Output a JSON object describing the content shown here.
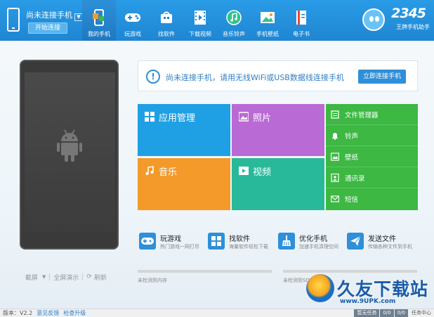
{
  "header": {
    "device_name": "尚未连接手机",
    "connect_label": "开始连接",
    "nav": [
      {
        "label": "我的手机",
        "icon": "phone-icon",
        "active": true
      },
      {
        "label": "玩游戏",
        "icon": "gamepad-icon"
      },
      {
        "label": "找软件",
        "icon": "app-store-icon"
      },
      {
        "label": "下载视频",
        "icon": "film-icon"
      },
      {
        "label": "音乐铃声",
        "icon": "music-note-icon"
      },
      {
        "label": "手机壁纸",
        "icon": "image-icon"
      },
      {
        "label": "电子书",
        "icon": "book-icon"
      }
    ],
    "brand_number": "2345",
    "brand_subtitle": "王牌手机助手"
  },
  "notice": {
    "text": "尚未连接手机，请用无线WiFi或USB数据线连接手机",
    "button": "立即连接手机"
  },
  "tiles": {
    "apps": "应用管理",
    "photos": "照片",
    "music": "音乐",
    "video": "视频"
  },
  "side_menu": [
    {
      "label": "文件管理器",
      "icon": "folder-icon"
    },
    {
      "label": "铃声",
      "icon": "bell-icon"
    },
    {
      "label": "壁纸",
      "icon": "wallpaper-icon"
    },
    {
      "label": "通讯录",
      "icon": "contacts-icon"
    },
    {
      "label": "短信",
      "icon": "mail-icon"
    }
  ],
  "shortcuts": [
    {
      "title": "玩游戏",
      "desc": "热门游戏一网打尽",
      "icon": "gamepad-icon"
    },
    {
      "title": "找软件",
      "desc": "海量软件轻松下载",
      "icon": "app-store-icon"
    },
    {
      "title": "优化手机",
      "desc": "加速手机清理空间",
      "icon": "broom-icon"
    },
    {
      "title": "发送文件",
      "desc": "传输各种文件到手机",
      "icon": "send-icon"
    }
  ],
  "storage": {
    "internal_label": "未检测到内存",
    "sd_label": "未检测到SD卡"
  },
  "phone_actions": {
    "screenshot": "截屏",
    "fullscreen": "全屏演示",
    "refresh": "刷新"
  },
  "status": {
    "version": "版本：V2.2",
    "feedback": "意见反馈",
    "check_update": "检查升级",
    "tasks": [
      "暂无任务",
      "0/0",
      "0/0"
    ],
    "task_center": "任务中心"
  },
  "watermark": {
    "text": "久友下载站",
    "url": "www.9UPK.com"
  },
  "colors": {
    "header": "#1f86d3",
    "apps_tile": "#1fa0e4",
    "photos_tile": "#b96ad4",
    "music_tile": "#f39a2a",
    "video_tile": "#27b99a",
    "side_menu": "#3cb843"
  }
}
